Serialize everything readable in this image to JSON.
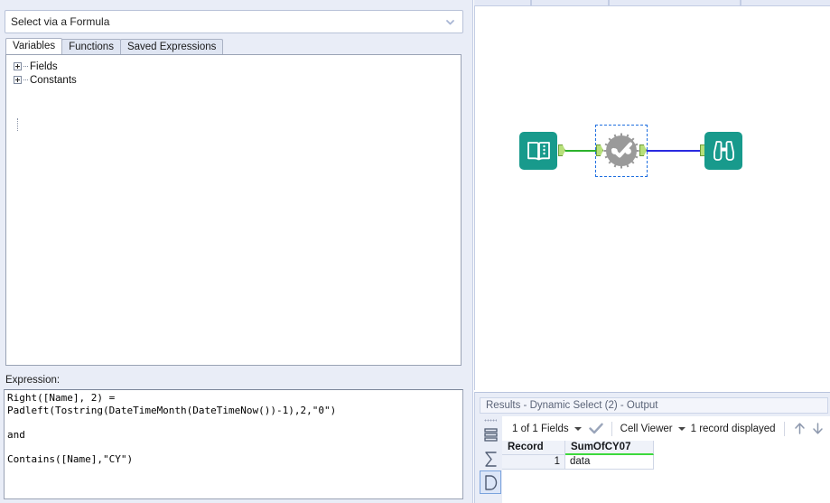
{
  "config": {
    "mode_select": {
      "value": "Select via a Formula",
      "dropdown_icon": "chevron-down-icon"
    },
    "tabs": [
      {
        "label": "Variables",
        "active": true
      },
      {
        "label": "Functions",
        "active": false
      },
      {
        "label": "Saved Expressions",
        "active": false
      }
    ],
    "tree": [
      {
        "label": "Fields",
        "expander": "plus"
      },
      {
        "label": "Constants",
        "expander": "plus"
      }
    ],
    "expression": {
      "label": "Expression:",
      "text": "Right([Name], 2) =\nPadleft(Tostring(DateTimeMonth(DateTimeNow())-1),2,\"0\")\n\nand\n\nContains([Name],\"CY\")"
    }
  },
  "canvas": {
    "nodes": [
      {
        "id": "input-data",
        "icon": "book-icon",
        "color": "#189a8c",
        "selected": false
      },
      {
        "id": "dynamic-select-macro",
        "icon": "gear-check-icon",
        "color": "#9a9a9a",
        "selected": true
      },
      {
        "id": "browse",
        "icon": "binoculars-icon",
        "color": "#189a8c",
        "selected": false
      }
    ],
    "connections": [
      {
        "from": "input-data",
        "to": "dynamic-select-macro",
        "color": "#2cb22c"
      },
      {
        "from": "dynamic-select-macro",
        "to": "browse",
        "color": "#2a2ae0"
      }
    ],
    "anchor_color": "#b7e07a",
    "selection_color": "#1f6fe0"
  },
  "results": {
    "title_prefix": "Results",
    "title": "Results - Dynamic Select (2) - Output",
    "sidebar_icons": [
      {
        "name": "grip-handle",
        "active": false
      },
      {
        "name": "data-table-icon",
        "active": false
      },
      {
        "name": "sigma-summary-icon",
        "active": false
      },
      {
        "name": "messages-icon",
        "active": true
      }
    ],
    "toolbar": {
      "fields_label": "1 of 1 Fields",
      "fields_caret": "chevron-down-icon",
      "apply_icon": "checkmark-icon",
      "cell_viewer_label": "Cell Viewer",
      "cell_viewer_caret": "chevron-down-icon",
      "record_count_label": "1 record displayed",
      "nav_up_icon": "arrow-up-icon",
      "nav_down_icon": "arrow-down-icon"
    },
    "grid": {
      "columns": [
        {
          "label": "Record",
          "type": "index"
        },
        {
          "label": "SumOfCY07",
          "type": "string",
          "type_color": "#3dd93d"
        }
      ],
      "rows": [
        {
          "Record": "1",
          "SumOfCY07": "data"
        }
      ]
    }
  }
}
